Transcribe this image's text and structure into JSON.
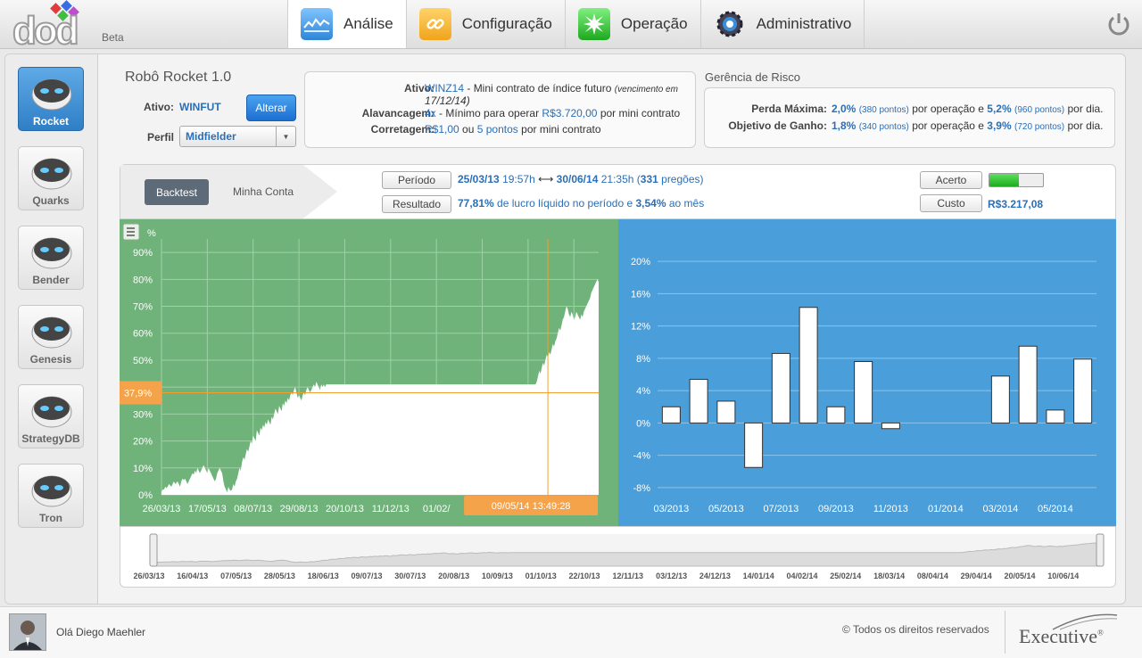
{
  "app": {
    "logo": "dod",
    "beta": "Beta"
  },
  "nav": {
    "tabs": [
      {
        "label": "Análise",
        "icon": "chart-icon"
      },
      {
        "label": "Configuração",
        "icon": "link-icon"
      },
      {
        "label": "Operação",
        "icon": "burst-icon"
      },
      {
        "label": "Administrativo",
        "icon": "gear-icon"
      }
    ]
  },
  "robots": [
    {
      "label": "Rocket",
      "active": true
    },
    {
      "label": "Quarks"
    },
    {
      "label": "Bender"
    },
    {
      "label": "Genesis"
    },
    {
      "label": "StrategyDB"
    },
    {
      "label": "Tron"
    }
  ],
  "robot": {
    "title": "Robô Rocket 1.0",
    "ativo_label": "Ativo:",
    "ativo_value": "WINFUT",
    "alterar": "Alterar",
    "perfil_label": "Perfil",
    "perfil_value": "Midfielder"
  },
  "contract": {
    "ativo_label": "Ativo:",
    "ativo_code": "WINZ14",
    "ativo_desc": "- Mini contrato de índice futuro",
    "ativo_venc_1": "(vencimento em",
    "ativo_venc_2": "17/12/14)",
    "alav_label": "Alavancagem:",
    "alav_x": "4x",
    "alav_desc": "- Mínimo para operar",
    "alav_value": "R$3.720,00",
    "alav_tail": "por mini contrato",
    "corr_label": "Corretagem:",
    "corr_value": "R$1,00",
    "corr_mid": "ou",
    "corr_pts": "5 pontos",
    "corr_tail": "por mini contrato"
  },
  "risk": {
    "title": "Gerência de Risco",
    "perda_label": "Perda Máxima:",
    "perda_op": "2,0%",
    "perda_op_pts": "(380 pontos)",
    "perda_mid": "por operação e",
    "perda_dia": "5,2%",
    "perda_dia_pts": "(960 pontos)",
    "perda_tail": "por dia.",
    "obj_label": "Objetivo de Ganho:",
    "obj_op": "1,8%",
    "obj_op_pts": "(340 pontos)",
    "obj_mid": "por operação e",
    "obj_dia": "3,9%",
    "obj_dia_pts": "(720 pontos)",
    "obj_tail": "por dia."
  },
  "band": {
    "backtest": "Backtest",
    "minha_conta": "Minha Conta",
    "periodo_btn": "Período",
    "periodo_start_date": "25/03/13",
    "periodo_start_time": "19:57h",
    "periodo_arrow": "⟷",
    "periodo_end_date": "30/06/14",
    "periodo_end_time": "21:35h",
    "periodo_open": "(",
    "periodo_count": "331",
    "periodo_count_tail": "pregões)",
    "resultado_btn": "Resultado",
    "resultado_pct": "77,81%",
    "resultado_mid": "de lucro líquido no período e",
    "resultado_month": "3,54%",
    "resultado_tail": "ao mês",
    "acerto_btn": "Acerto",
    "acerto_level": 0.55,
    "custo_btn": "Custo",
    "custo_value": "R$3.217,08"
  },
  "chart_data": [
    {
      "type": "area",
      "unit_label": "%",
      "y_ticks": [
        "0%",
        "10%",
        "20%",
        "30%",
        "40%",
        "50%",
        "60%",
        "70%",
        "80%",
        "90%"
      ],
      "ylim": [
        0,
        95
      ],
      "x_ticks": [
        "26/03/13",
        "17/05/13",
        "08/07/13",
        "29/08/13",
        "20/10/13",
        "11/12/13",
        "01/02/"
      ],
      "x_tick_index": [
        0,
        37,
        74,
        111,
        148,
        185,
        222
      ],
      "cursor_value_label": "37,9%",
      "cursor_value": 37.9,
      "cursor_date_label": "09/05/14 13:49:28",
      "cursor_index": 312,
      "values": [
        1,
        2,
        2,
        3,
        2.5,
        3,
        4,
        3.5,
        3,
        4,
        5,
        4,
        4.5,
        5,
        4,
        3,
        5,
        6,
        5.5,
        6,
        5,
        4,
        5,
        6,
        7,
        8,
        7.5,
        9,
        8,
        10,
        9,
        8,
        9,
        10,
        11,
        10,
        9,
        8,
        10,
        9,
        8,
        7,
        6,
        5,
        6,
        8,
        9,
        10,
        9,
        8,
        5,
        3,
        2,
        1,
        3,
        2,
        1.5,
        2,
        4,
        3,
        5,
        6,
        8,
        10,
        9,
        12,
        14,
        13,
        15,
        17,
        16,
        18,
        20,
        19,
        22,
        21,
        20,
        24,
        23,
        22,
        25,
        24,
        26,
        25,
        27,
        26,
        28,
        27,
        26,
        29,
        28,
        30,
        32,
        31,
        30,
        33,
        32,
        31,
        34,
        33,
        35,
        34,
        36,
        35,
        37,
        38,
        37,
        39,
        40,
        38,
        36,
        37,
        36,
        35,
        37,
        38,
        37,
        39,
        40,
        39,
        38,
        39,
        40,
        41,
        40,
        42,
        41,
        40,
        39,
        41,
        40,
        41,
        40,
        41,
        41,
        41,
        41,
        41,
        41,
        41,
        41,
        41,
        41,
        41,
        41,
        41,
        41,
        41,
        41,
        41,
        41,
        41,
        41,
        41,
        41,
        41,
        41,
        41,
        41,
        41,
        41,
        41,
        41,
        41,
        41,
        41,
        41,
        41,
        41,
        41,
        41,
        41,
        41,
        41,
        41,
        41,
        41,
        41,
        41,
        41,
        41,
        41,
        41,
        41,
        41,
        41,
        41,
        41,
        41,
        41,
        41,
        41,
        41,
        41,
        41,
        41,
        41,
        41,
        41,
        41,
        41,
        41,
        41,
        41,
        41,
        41,
        41,
        41,
        41,
        41,
        41,
        41,
        41,
        41,
        41,
        41,
        41,
        41,
        41,
        41,
        41,
        41,
        41,
        41,
        41,
        41,
        41,
        41,
        41,
        41,
        41,
        41,
        41,
        41,
        41,
        41,
        41,
        41,
        41,
        41,
        41,
        41,
        41,
        41,
        41,
        41,
        41,
        41,
        41,
        41,
        41,
        41,
        41,
        41,
        41,
        41,
        41,
        41,
        41,
        41,
        41,
        41,
        41,
        41,
        41,
        41,
        41,
        41,
        41,
        41,
        41,
        41,
        41,
        41,
        41,
        41,
        41,
        41,
        41,
        41,
        41,
        41,
        41,
        41,
        41,
        41,
        41,
        41,
        41,
        41,
        41,
        41,
        41,
        41,
        41,
        41,
        41,
        41,
        41,
        41,
        41,
        41,
        41,
        42,
        44,
        46,
        45,
        47,
        49,
        48,
        50,
        52,
        51,
        53,
        52,
        54,
        56,
        55,
        57,
        58,
        60,
        62,
        61,
        63,
        65,
        66,
        68,
        70,
        69,
        67,
        66,
        68,
        67,
        65,
        66,
        68,
        67,
        66,
        65,
        67,
        66,
        68,
        69,
        70,
        71,
        72,
        73,
        75,
        76,
        77,
        78,
        79,
        80,
        79
      ]
    },
    {
      "type": "bar",
      "y_ticks": [
        "-8%",
        "-4%",
        "0%",
        "4%",
        "8%",
        "12%",
        "16%",
        "20%"
      ],
      "ylim": [
        -9,
        21
      ],
      "x_ticks": [
        "03/2013",
        "05/2013",
        "07/2013",
        "09/2013",
        "11/2013",
        "01/2014",
        "03/2014",
        "05/2014"
      ],
      "categories": [
        "03/2013",
        "04/2013",
        "05/2013",
        "06/2013",
        "07/2013",
        "08/2013",
        "09/2013",
        "10/2013",
        "11/2013",
        "12/2013",
        "01/2014",
        "02/2014",
        "03/2014",
        "04/2014",
        "05/2014",
        "06/2014"
      ],
      "values": [
        2.0,
        5.4,
        2.7,
        -5.5,
        8.6,
        14.3,
        2.0,
        7.6,
        -0.7,
        0,
        0,
        0,
        5.8,
        9.5,
        1.6,
        7.9
      ]
    },
    {
      "type": "area",
      "x_ticks": [
        "26/03/13",
        "16/04/13",
        "07/05/13",
        "28/05/13",
        "18/06/13",
        "09/07/13",
        "30/07/13",
        "20/08/13",
        "10/09/13",
        "01/10/13",
        "22/10/13",
        "12/11/13",
        "03/12/13",
        "24/12/13",
        "14/01/14",
        "04/02/14",
        "25/02/14",
        "18/03/14",
        "08/04/14",
        "29/04/14",
        "20/05/14",
        "10/06/14"
      ]
    }
  ],
  "footer": {
    "greeting": "Olá Diego Maehler",
    "copyright": "© Todos os direitos reservados",
    "brand": "Executive",
    "brand_mark": "®"
  }
}
